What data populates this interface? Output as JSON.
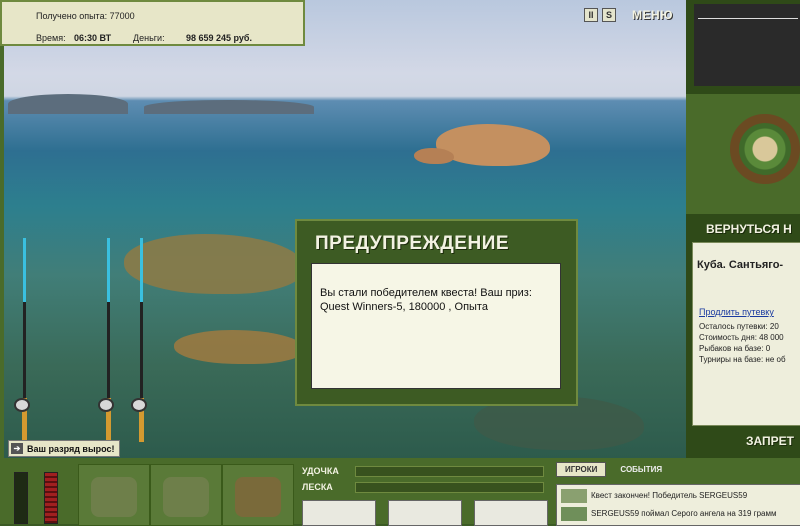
{
  "hud": {
    "experience": "Получено опыта: 77000",
    "time_label": "Время:",
    "time_value": "06:30 ВТ",
    "money_label": "Деньги:",
    "money_value": "98 659 245 руб."
  },
  "top": {
    "pause": "II",
    "sound": "S",
    "menu": "МЕНЮ"
  },
  "right_panel": {
    "back_button": "ВЕРНУТЬСЯ Н",
    "location": "Куба. Сантьяго-",
    "extend_link": "Продлить путевку",
    "lines": [
      "Осталось путевки: 20",
      "Стоимость дня: 48 000",
      "Рыбаков на базе: 0",
      "Турниры на базе: не об"
    ],
    "ban_button": "ЗАПРЕТ"
  },
  "rank_message": "Ваш разряд вырос!",
  "dialog": {
    "title": "ПРЕДУПРЕЖДЕНИЕ",
    "message": "Вы стали победителем квеста! Ваш приз: Quest Winners-5, 180000 , Опыта"
  },
  "bottom": {
    "rod_label": "УДОЧКА",
    "line_label": "ЛЕСКА",
    "tab_players": "ИГРОКИ",
    "tab_events": "СОБЫТИЯ",
    "chat_line1": "Квест закончен! Победитель SERGEUS59",
    "chat_line2": "SERGEUS59 поймал Серого ангела на 319 грамм"
  },
  "colors": {
    "panel": "#4a6b2a",
    "dark_panel": "#2f4a18",
    "paper": "#f6f6e6",
    "accent_text": "#f2f2e2"
  }
}
